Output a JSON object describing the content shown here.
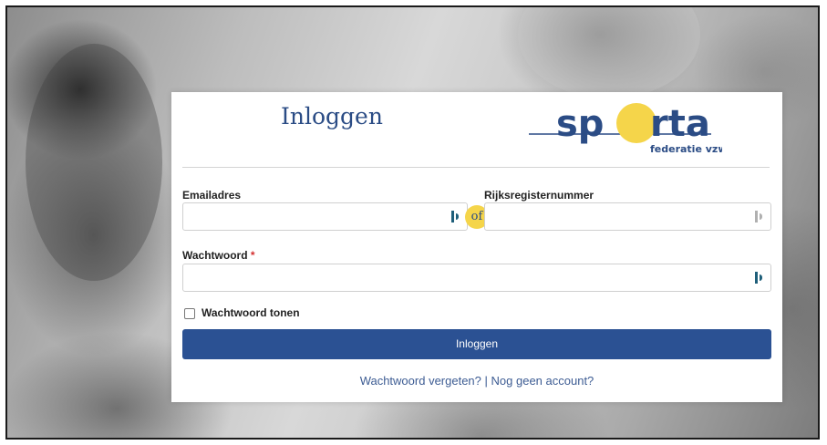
{
  "login": {
    "title": "Inloggen",
    "logo": {
      "wordmark": "sporta",
      "tagline": "federatie vzw",
      "colors": {
        "blue": "#2b4c85",
        "yellow": "#f5d54a"
      }
    },
    "email": {
      "label": "Emailadres",
      "value": ""
    },
    "or_badge": "of",
    "rijksregister": {
      "label": "Rijksregisternummer",
      "value": ""
    },
    "password": {
      "label": "Wachtwoord",
      "required_mark": "*",
      "value": ""
    },
    "show_password": {
      "label": "Wachtwoord tonen",
      "checked": false
    },
    "submit_label": "Inloggen",
    "links": {
      "forgot": "Wachtwoord vergeten?",
      "separator": "|",
      "register": "Nog geen account?"
    }
  },
  "colors": {
    "primary": "#2b5193",
    "accent": "#f5d54a",
    "required": "#d32f2f",
    "field_icon_active": "#1f5f7a",
    "field_icon_inactive": "#b0b0b0"
  },
  "icons": {
    "email_field": "password-manager-icon",
    "rijksregister_field": "password-manager-icon",
    "password_field": "password-manager-icon"
  }
}
